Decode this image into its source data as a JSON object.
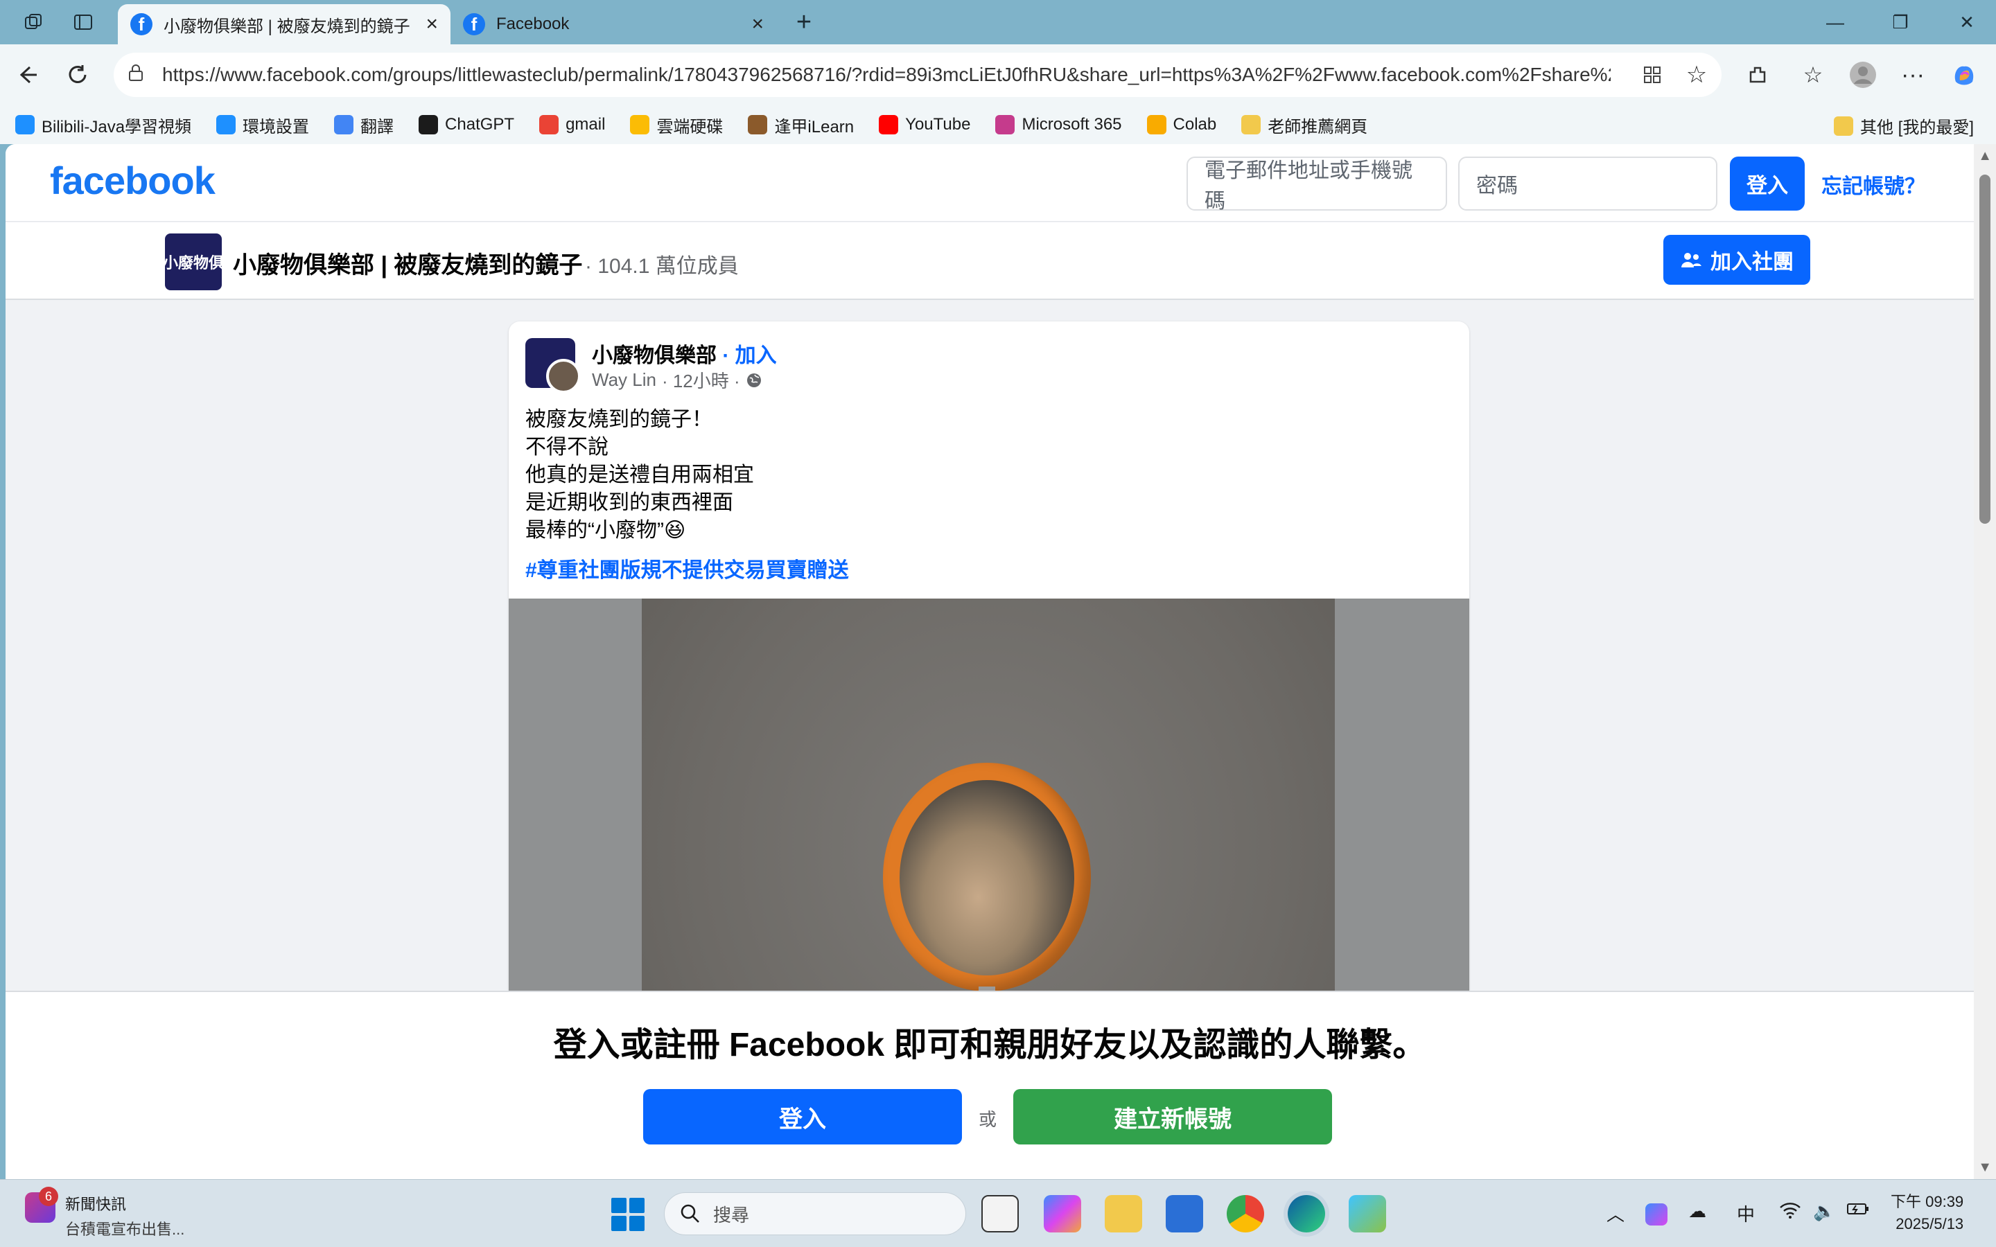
{
  "browser": {
    "tabs": [
      {
        "title": "小廢物俱樂部 | 被廢友燒到的鏡子",
        "active": true
      },
      {
        "title": "Facebook",
        "active": false
      }
    ],
    "url": "https://www.facebook.com/groups/littlewasteclub/permalink/1780437962568716/?rdid=89i3mcLiEtJ0fhRU&share_url=https%3A%2F%2Fwww.facebook.com%2Fshare%2F...",
    "bookmarks": [
      {
        "label": "Bilibili-Java學習視頻",
        "color": "#1e90ff"
      },
      {
        "label": "環境設置",
        "color": "#1e90ff"
      },
      {
        "label": "翻譯",
        "color": "#4285f4"
      },
      {
        "label": "ChatGPT",
        "color": "#1b1b1b"
      },
      {
        "label": "gmail",
        "color": "#ea4335"
      },
      {
        "label": "雲端硬碟",
        "color": "#fbbc05"
      },
      {
        "label": "逢甲iLearn",
        "color": "#8b5a2b"
      },
      {
        "label": "YouTube",
        "color": "#ff0000"
      },
      {
        "label": "Microsoft 365",
        "color": "#c53b8c"
      },
      {
        "label": "Colab",
        "color": "#f9ab00"
      },
      {
        "label": "老師推薦網頁",
        "color": "#f2c94c"
      }
    ],
    "other_bookmarks": "其他 [我的最愛]"
  },
  "fb": {
    "logo": "facebook",
    "email_placeholder": "電子郵件地址或手機號碼",
    "password_placeholder": "密碼",
    "login_label": "登入",
    "forgot_label": "忘記帳號？",
    "group": {
      "thumb_text": "小廢物俱",
      "name": "小廢物俱樂部 | 被廢友燒到的鏡子",
      "members": "· 104.1 萬位成員",
      "join_label": "加入社團"
    },
    "post": {
      "group_name": "小廢物俱樂部",
      "join_text": "· 加入",
      "author": "Way Lin",
      "time": "· 12小時 ·",
      "lines": [
        "被廢友燒到的鏡子！",
        "不得不說",
        "他真的是送禮自用兩相宜",
        "是近期收到的東西裡面",
        "最棒的“小廢物”😆"
      ],
      "hashtag": "#尊重社團版規不提供交易買賣贈送"
    },
    "banner": {
      "text": "登入或註冊 Facebook 即可和親朋好友以及認識的人聯繫。",
      "login_label": "登入",
      "or_label": "或",
      "create_label": "建立新帳號"
    }
  },
  "taskbar": {
    "news_badge": "6",
    "news_title": "新聞快訊",
    "news_sub": "台積電宣布出售...",
    "search_placeholder": "搜尋",
    "ime": "中",
    "time_period": "下午 09:39",
    "date": "2025/5/13"
  }
}
